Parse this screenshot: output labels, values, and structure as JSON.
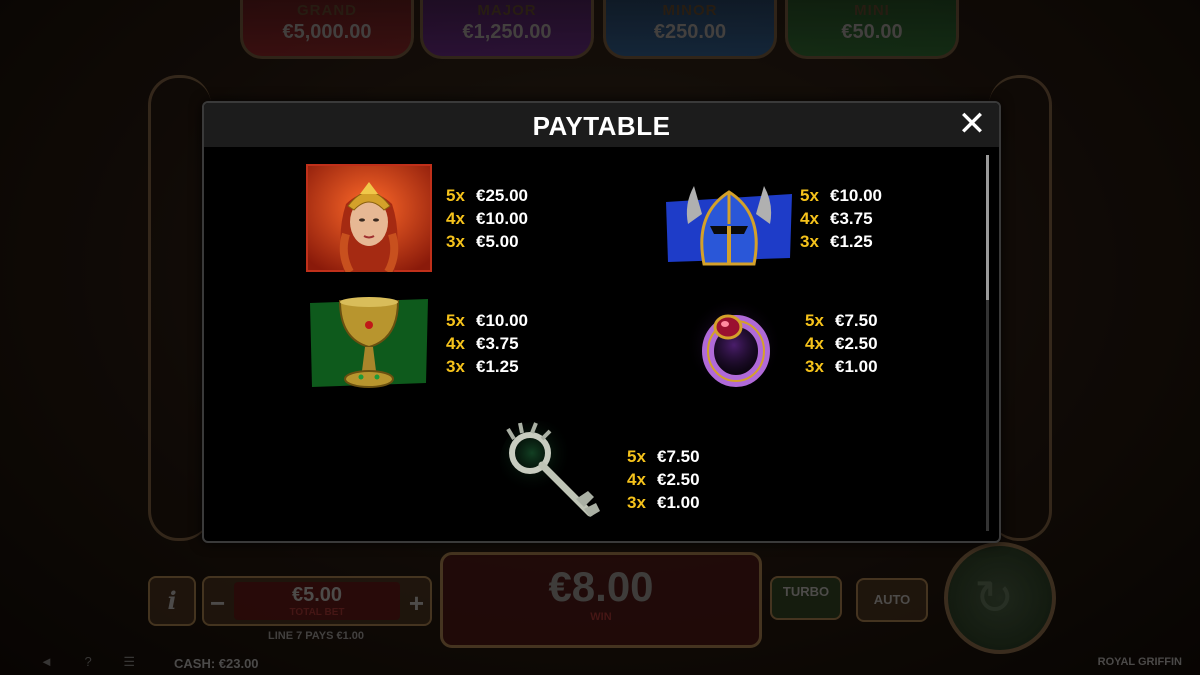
{
  "jackpots": [
    {
      "name": "GRAND",
      "value": "€5,000.00"
    },
    {
      "name": "MAJOR",
      "value": "€1,250.00"
    },
    {
      "name": "MINOR",
      "value": "€250.00"
    },
    {
      "name": "MINI",
      "value": "€50.00"
    }
  ],
  "paytable": {
    "title": "PAYTABLE",
    "close_icon": "close-icon",
    "symbols": [
      {
        "name": "queen",
        "pays": [
          {
            "count": "5x",
            "amount": "€25.00"
          },
          {
            "count": "4x",
            "amount": "€10.00"
          },
          {
            "count": "3x",
            "amount": "€5.00"
          }
        ]
      },
      {
        "name": "helmet",
        "pays": [
          {
            "count": "5x",
            "amount": "€10.00"
          },
          {
            "count": "4x",
            "amount": "€3.75"
          },
          {
            "count": "3x",
            "amount": "€1.25"
          }
        ]
      },
      {
        "name": "chalice",
        "pays": [
          {
            "count": "5x",
            "amount": "€10.00"
          },
          {
            "count": "4x",
            "amount": "€3.75"
          },
          {
            "count": "3x",
            "amount": "€1.25"
          }
        ]
      },
      {
        "name": "ring",
        "pays": [
          {
            "count": "5x",
            "amount": "€7.50"
          },
          {
            "count": "4x",
            "amount": "€2.50"
          },
          {
            "count": "3x",
            "amount": "€1.00"
          }
        ]
      },
      {
        "name": "key",
        "pays": [
          {
            "count": "5x",
            "amount": "€7.50"
          },
          {
            "count": "4x",
            "amount": "€2.50"
          },
          {
            "count": "3x",
            "amount": "€1.00"
          }
        ]
      }
    ]
  },
  "controls": {
    "info_label": "i",
    "bet_minus": "−",
    "bet_plus": "+",
    "total_bet_value": "€5.00",
    "total_bet_label": "TOTAL BET",
    "line_pays": "LINE 7 PAYS €1.00",
    "win_value": "€8.00",
    "win_label": "WIN",
    "turbo_label": "TURBO",
    "auto_label": "AUTO",
    "spin_icon": "spin-icon"
  },
  "status": {
    "cash": "CASH:  €23.00",
    "game_name": "ROYAL GRIFFIN"
  },
  "colors": {
    "multiplier_yellow": "#f5c21b",
    "modal_background": "#000000",
    "header_background": "#1c1c1c"
  }
}
